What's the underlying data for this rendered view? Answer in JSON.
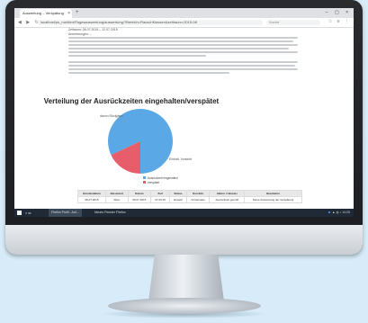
{
  "browser": {
    "tab_title": "Auswertung – Verspätung",
    "tab_close": "×",
    "new_tab": "+",
    "window_controls": "– ▢ ×",
    "nav_glyphs": "◀ ▶ ↻",
    "url": "localhost/ps_ma/html/Tagesauswertung/auswertung/?Bereich=RauschKlassen&zeitraum=2015-08",
    "search_placeholder": "Suche",
    "tools": "☆ ≡ ⋮"
  },
  "page": {
    "meta_lines": [
      "Zeitraum: 06.07.2015 – 12.07.2015",
      "Anmerkungen: –"
    ],
    "chart_title": "Verteilung der Ausrückzeiten eingehalten/verspätet",
    "slice_labels": [
      "davon Rückfahrt",
      "Einhalt. Vorsicht"
    ],
    "legend": [
      {
        "label": "Ausrückzeit eingehalten",
        "color": "#5aa9e6"
      },
      {
        "label": "verspätet",
        "color": "#e85d6b"
      }
    ]
  },
  "chart_data": {
    "type": "pie",
    "title": "Verteilung der Ausrückzeiten eingehalten/verspätet",
    "labels": [
      "Ausrückzeit eingehalten",
      "verspätet"
    ],
    "values": [
      82,
      18
    ],
    "colors": [
      "#5aa9e6",
      "#e85d6b"
    ],
    "legend": "bottom"
  },
  "table": {
    "headers": [
      "Einsatzdatum",
      "Einsatzort",
      "Datum",
      "Zeit",
      "Status",
      "Kurzinfo",
      "Aktion / Hinweis",
      "Bearbeiter"
    ],
    "row": [
      "08.07.2015",
      "Wien",
      "06.07.2015",
      "07:23:15",
      "Einsatz",
      "Vorderseite",
      "Ausrückzeit geprüft",
      "Keine Auswertung der Verspätung"
    ]
  },
  "taskbar": {
    "search": "⌕  ▭",
    "app1": "Firefox Profil - Auf...",
    "app2": "Neues Fenster Firefox",
    "tray": "▲ ◍ ♪ 14:05"
  }
}
